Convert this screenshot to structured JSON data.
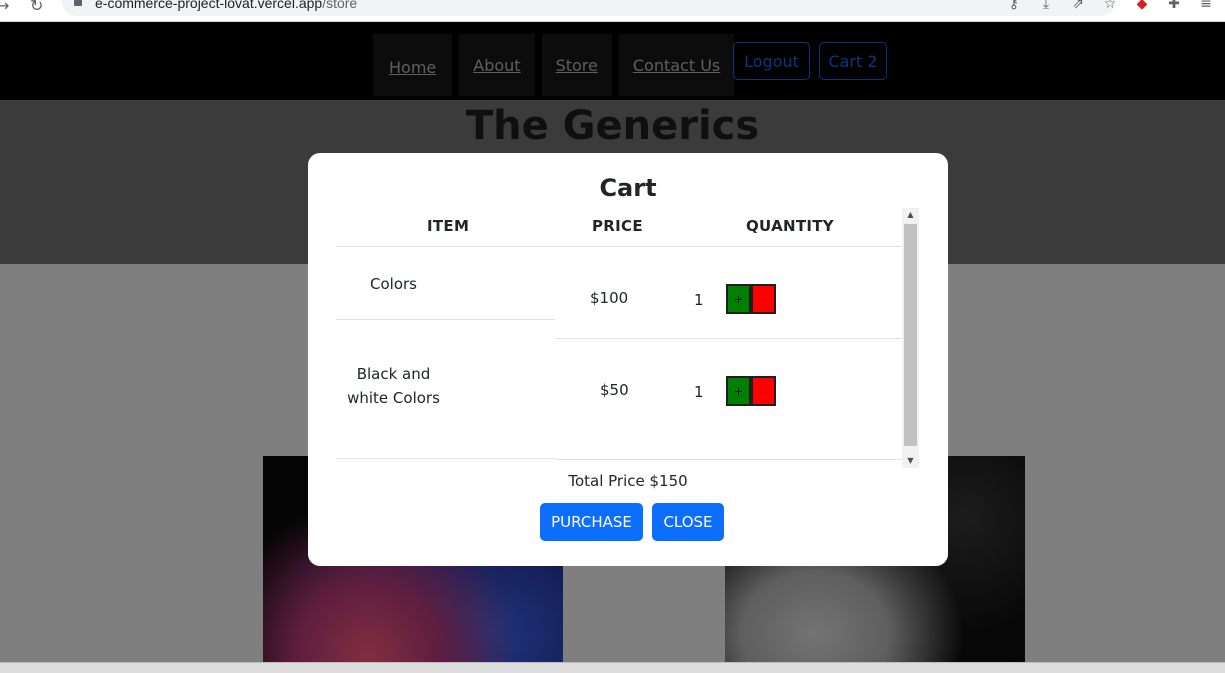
{
  "browser": {
    "url_host": "e-commerce-project-lovat.vercel.app",
    "url_path": "/store"
  },
  "site": {
    "nav": [
      "Home",
      "About",
      "Store",
      "Contact Us"
    ],
    "logout_label": "Logout",
    "cart_label": "Cart 2",
    "hero_title": "The Generics"
  },
  "modal": {
    "title": "Cart",
    "headers": {
      "item": "ITEM",
      "price": "PRICE",
      "quantity": "QUANTITY"
    },
    "rows": [
      {
        "item": "Colors",
        "price": "$100",
        "qty": "1"
      },
      {
        "item": "Black and white Colors",
        "price": "$50",
        "qty": "1"
      }
    ],
    "plus": "+",
    "minus": "-",
    "total": "Total Price $150",
    "purchase_label": "PURCHASE",
    "close_label": "CLOSE"
  },
  "colors": {
    "primary": "#0d6efd",
    "plus_button": "#008000",
    "minus_button": "#ff0000"
  }
}
